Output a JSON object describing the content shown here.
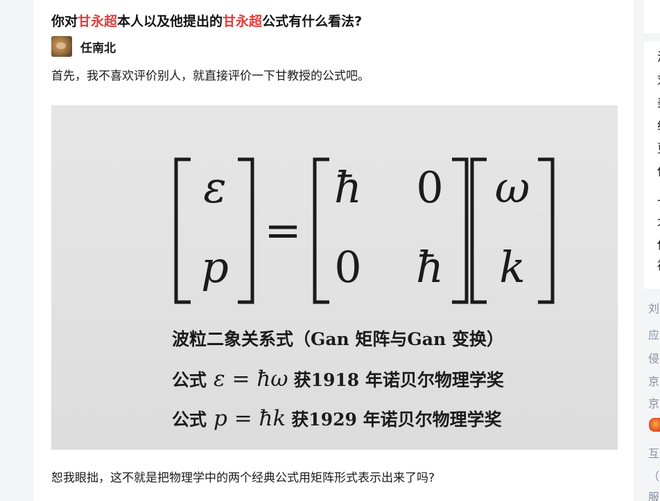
{
  "question": {
    "title_parts": [
      "你对",
      "甘永超",
      "本人以及他提出的",
      "甘永超",
      "公式有什么看法?"
    ],
    "highlight_color": "#e03c3c"
  },
  "answer": {
    "author_name": "任南北",
    "paragraph_1": "首先，我不喜欢评价别人，就直接评价一下甘教授的公式吧。",
    "paragraph_2": "恕我眼拙，这不就是把物理学中的两个经典公式用矩阵形式表示出来了吗?"
  },
  "formula_image": {
    "lhs_top": "ε",
    "lhs_bottom": "p",
    "equals": "=",
    "matrix_11": "ħ",
    "matrix_12": "0",
    "matrix_21": "0",
    "matrix_22": "ħ",
    "rhs_top": "ω",
    "rhs_bottom": "k",
    "caption_line_1": "波粒二象关系式（Gan 矩阵与Gan 变换）",
    "caption_line_2_prefix": "公式",
    "caption_line_2_formula": "ε = ħω",
    "caption_line_2_suffix": "获1918 年诺贝尔物理学奖",
    "caption_line_3_prefix": "公式",
    "caption_line_3_formula": "p = ħk",
    "caption_line_3_suffix": "获1929 年诺贝尔物理学奖"
  },
  "right_rail": {
    "card_chars": [
      "汤",
      "刘",
      "美",
      "纪",
      "更",
      "俢",
      "一",
      "才",
      "俢",
      "被"
    ],
    "list_chars": [
      "刘",
      "应",
      "侵",
      "京",
      "京",
      "互",
      "（",
      "服"
    ]
  }
}
